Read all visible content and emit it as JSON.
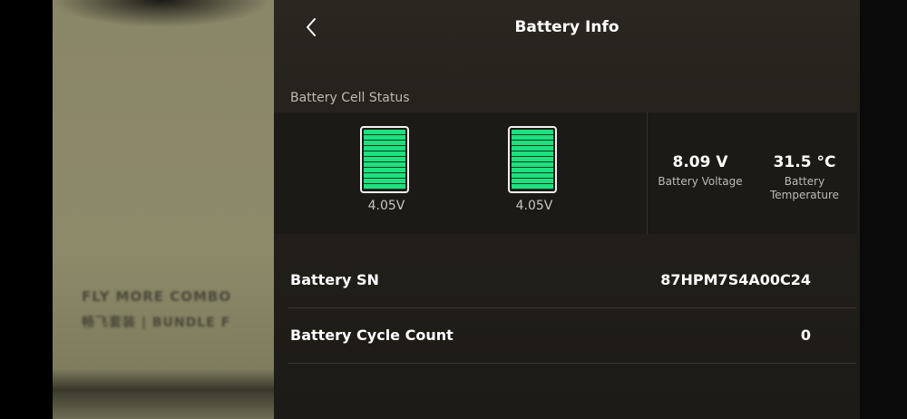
{
  "camera_view": {
    "text_line1": "FLY MORE COMBO",
    "text_line2": "畅飞套装 | BUNDLE F"
  },
  "header": {
    "title": "Battery Info",
    "back_icon": "chevron-left-icon"
  },
  "cell_status": {
    "section_label": "Battery Cell Status",
    "cells": [
      {
        "voltage": "4.05V",
        "fill_level": 1.0
      },
      {
        "voltage": "4.05V",
        "fill_level": 1.0
      }
    ],
    "cell_color": "#1ee07e",
    "battery_voltage": {
      "value": "8.09 V",
      "label": "Battery Voltage"
    },
    "battery_temperature": {
      "value": "31.5 °C",
      "label_line1": "Battery",
      "label_line2": "Temperature"
    }
  },
  "details": {
    "serial": {
      "label": "Battery SN",
      "value": "87HPM7S4A00C24"
    },
    "cycle_count": {
      "label": "Battery Cycle Count",
      "value": "0"
    }
  }
}
